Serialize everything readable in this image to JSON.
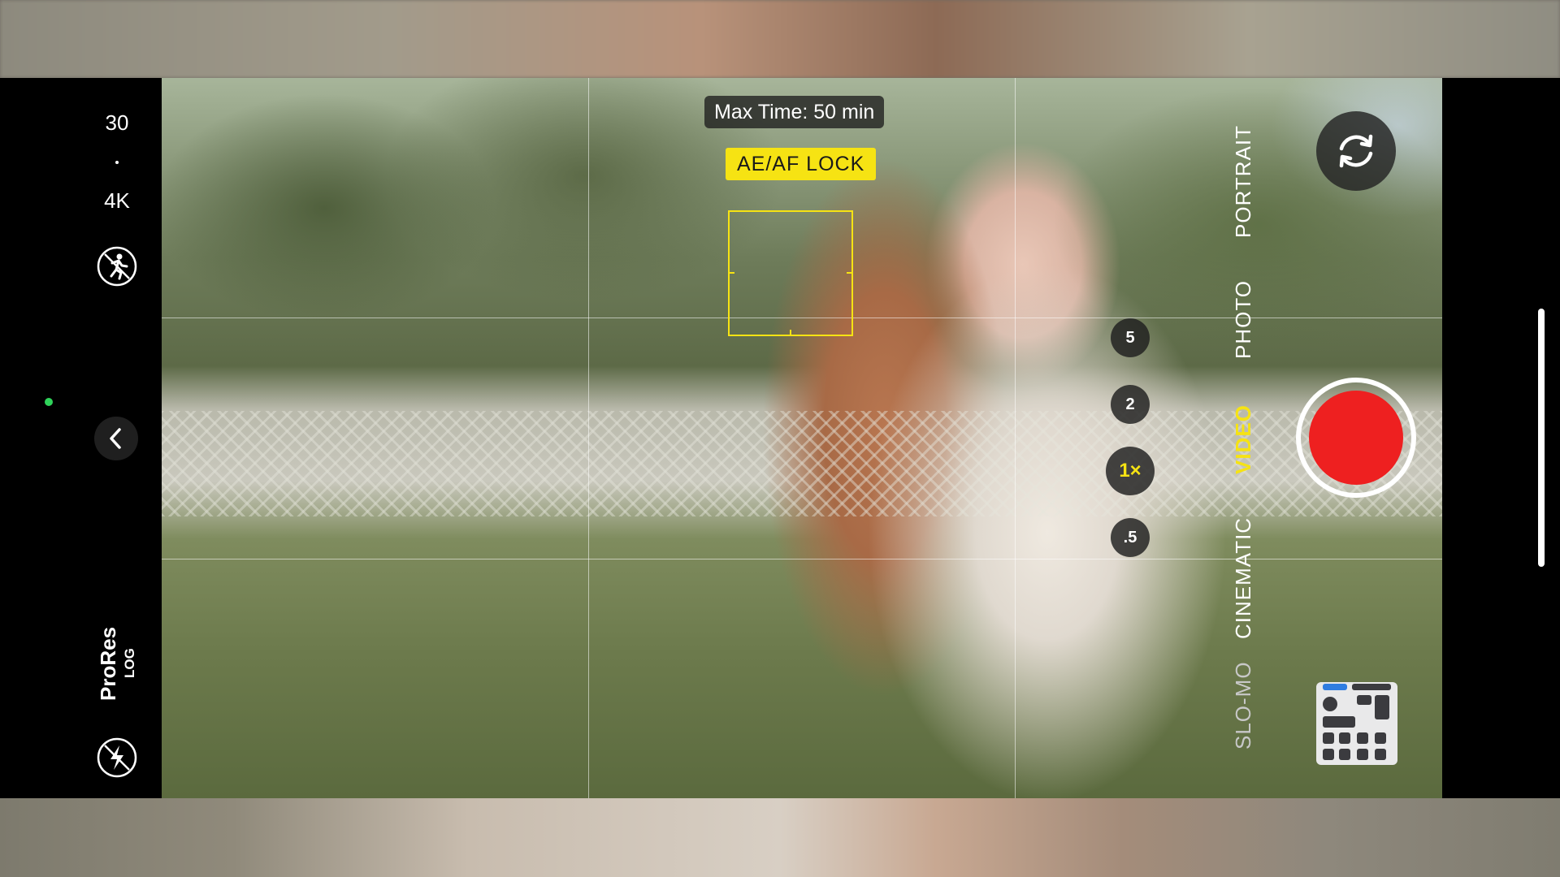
{
  "left_panel": {
    "frame_rate": "30",
    "separator": "·",
    "resolution": "4K",
    "stabilization_icon": "action-mode-off-icon",
    "back_icon": "chevron-left-icon",
    "format_primary": "ProRes",
    "format_secondary": "LOG",
    "flash_icon": "flash-off-icon",
    "indicator_color": "#2fd35a"
  },
  "overlays": {
    "max_time": "Max Time: 50 min",
    "lock_label": "AE/AF LOCK",
    "lock_color": "#f6e313"
  },
  "zoom": {
    "levels": [
      "5",
      "2",
      "1×",
      ".5"
    ],
    "selected": "1×"
  },
  "modes": {
    "items": [
      "PORTRAIT",
      "PHOTO",
      "VIDEO",
      "CINEMATIC",
      "SLO-MO"
    ],
    "selected": "VIDEO"
  },
  "right_panel": {
    "switch_camera_icon": "camera-switch-icon",
    "record_color": "#ee2020",
    "thumbnail_icon": "last-media-thumbnail"
  }
}
